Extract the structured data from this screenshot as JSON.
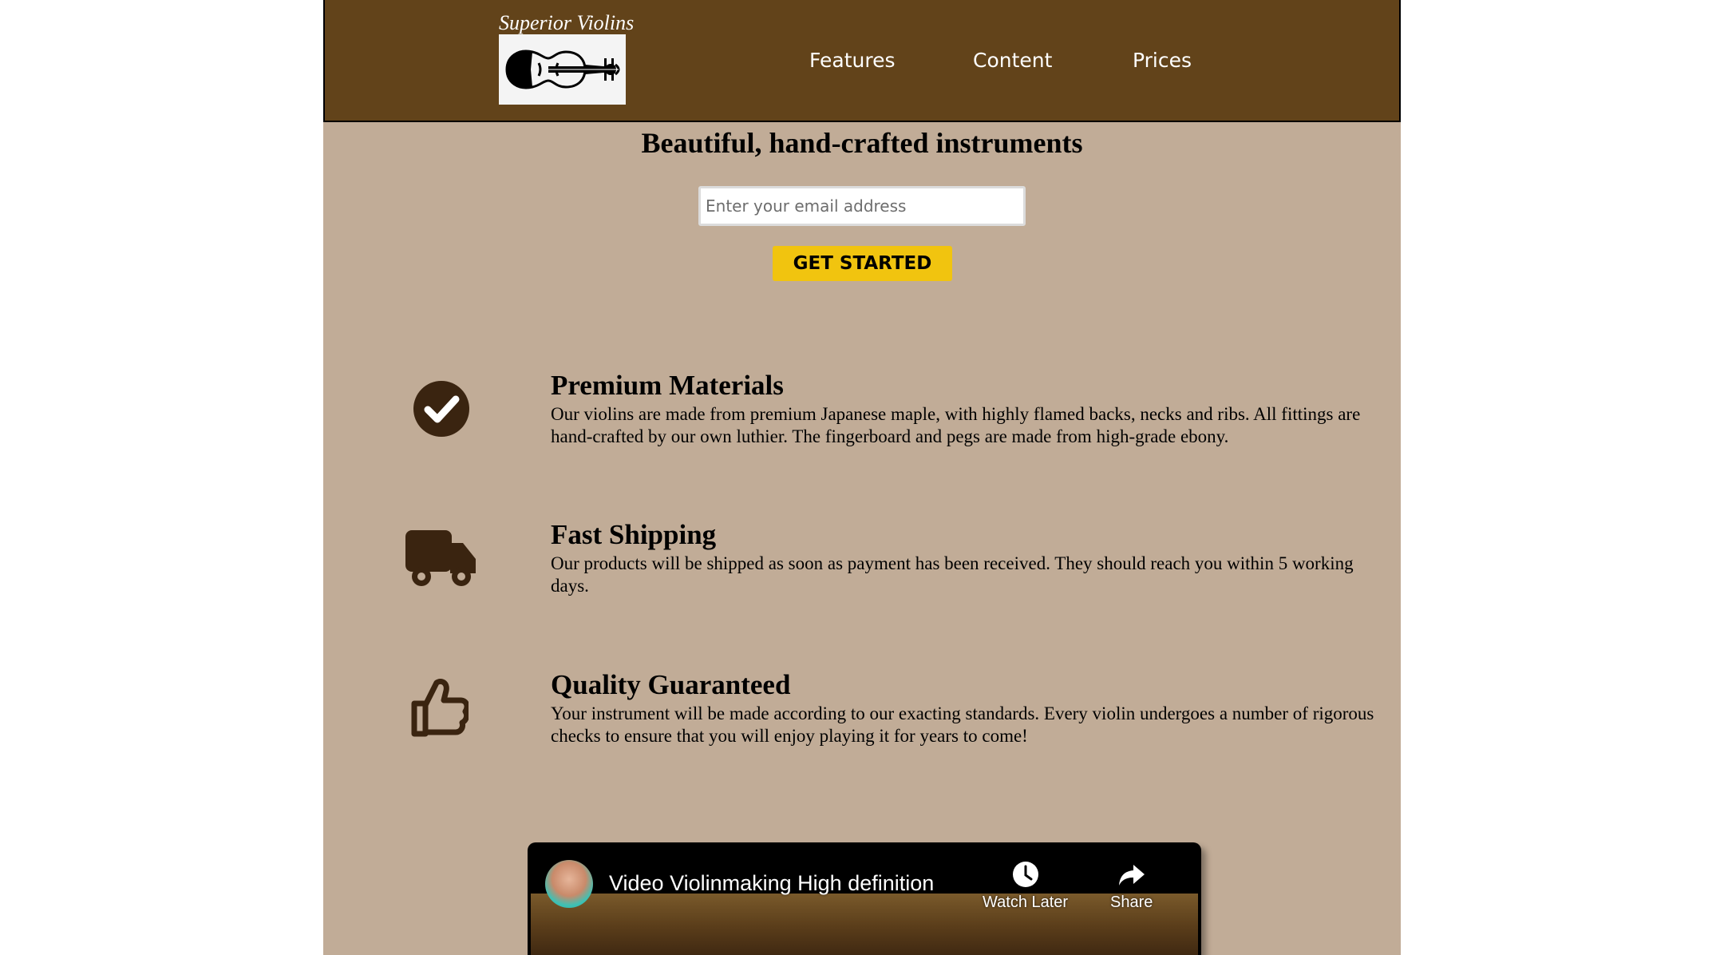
{
  "header": {
    "brand_name": "Superior Violins",
    "nav": [
      "Features",
      "Content",
      "Prices"
    ]
  },
  "hero": {
    "title": "Beautiful, hand-crafted instruments",
    "email_placeholder": "Enter your email address",
    "cta_label": "GET STARTED"
  },
  "features": [
    {
      "icon": "check-circle-icon",
      "title": "Premium Materials",
      "description": "Our violins are made from premium Japanese maple, with highly flamed backs, necks and ribs. All fittings are hand-crafted by our own luthier. The fingerboard and pegs are made from high-grade ebony."
    },
    {
      "icon": "truck-icon",
      "title": "Fast Shipping",
      "description": "Our products will be shipped as soon as payment has been received. They should reach you within 5 working days."
    },
    {
      "icon": "thumbs-up-icon",
      "title": "Quality Guaranteed",
      "description": "Your instrument will be made according to our exacting standards. Every violin undergoes a number of rigorous checks to ensure that you will enjoy playing it for years to come!"
    }
  ],
  "video": {
    "title": "Video Violinmaking High definition",
    "watch_later_label": "Watch Later",
    "share_label": "Share"
  },
  "colors": {
    "page_background": "#c1ac97",
    "header_background": "#62431a",
    "cta_background": "#f1c40f",
    "icon_color": "#3a2410"
  }
}
